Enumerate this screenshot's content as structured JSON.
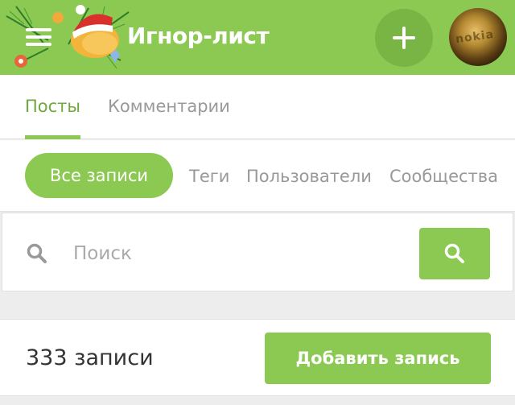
{
  "header": {
    "title": "Игнор-лист",
    "menu_icon": "hamburger-menu-icon",
    "logo": "holiday-mascot-logo",
    "add_icon": "plus-icon",
    "avatar_text": "nokia"
  },
  "tabs": [
    {
      "label": "Посты",
      "active": true
    },
    {
      "label": "Комментарии",
      "active": false
    }
  ],
  "filters": {
    "all_records": "Все записи",
    "tags": "Теги",
    "users": "Пользователи",
    "communities": "Сообщества"
  },
  "search": {
    "placeholder": "Поиск",
    "icon": "search-icon"
  },
  "summary": {
    "count_label": "333 записи",
    "add_button": "Добавить запись"
  },
  "colors": {
    "accent": "#8bc952",
    "accent_dark": "#78b545",
    "active_tab_text": "#6fa83b",
    "muted_text": "#999999"
  }
}
